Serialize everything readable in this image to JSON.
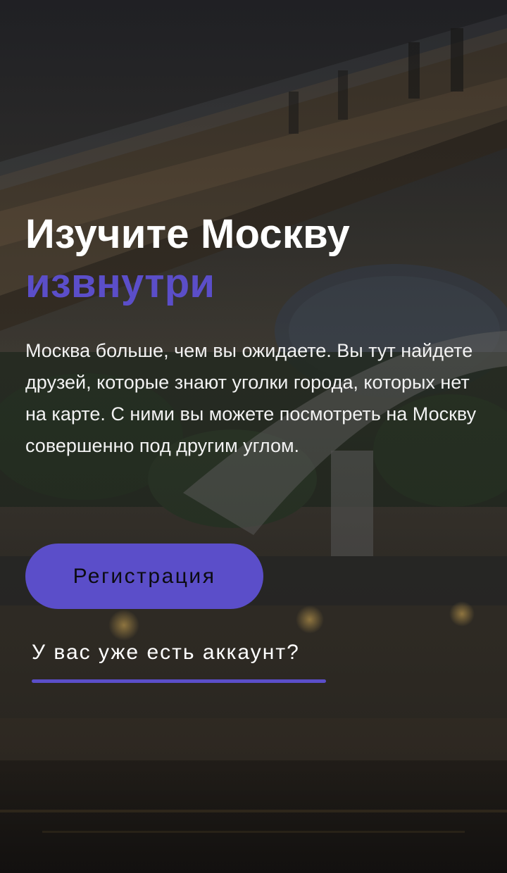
{
  "hero": {
    "title_line1": "Изучите Москву",
    "title_line2": "извнутри",
    "description": "Москва больше, чем вы ожидаете. Вы тут найдете друзей, которые знают уголки города, которых нет на карте. С ними вы можете посмотреть на Москву совершенно под другим углом."
  },
  "actions": {
    "register_label": "Регистрация",
    "login_label": "У вас уже есть аккаунт?"
  },
  "colors": {
    "accent": "#5b4ec9",
    "text": "#ffffff",
    "overlay": "#0a0a0c"
  }
}
